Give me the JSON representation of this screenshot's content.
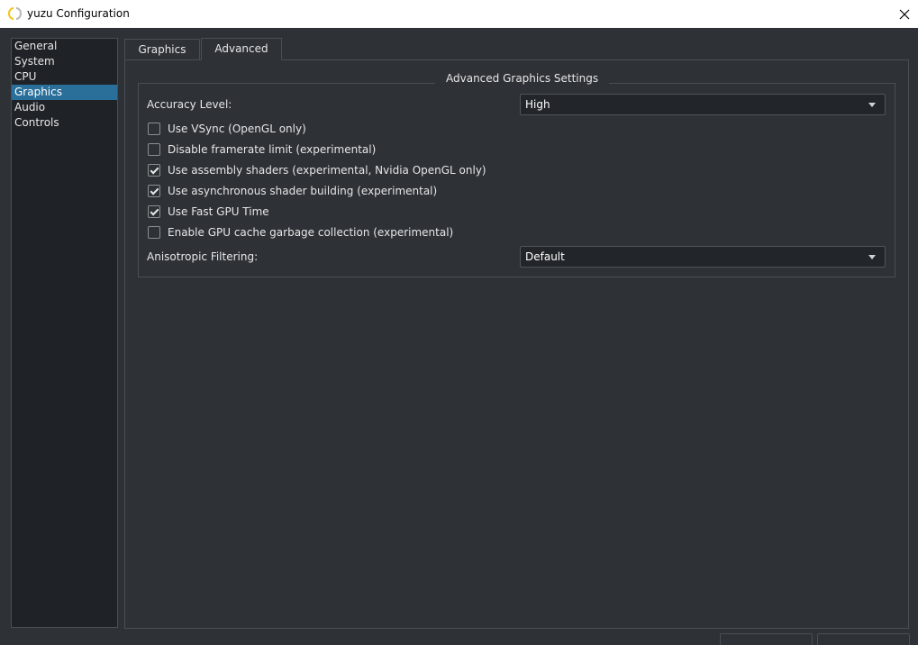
{
  "window": {
    "title": "yuzu Configuration",
    "icon": "yuzu-logo-icon",
    "close_icon": "close-icon"
  },
  "sidebar": {
    "items": [
      {
        "label": "General",
        "selected": false
      },
      {
        "label": "System",
        "selected": false
      },
      {
        "label": "CPU",
        "selected": false
      },
      {
        "label": "Graphics",
        "selected": true
      },
      {
        "label": "Audio",
        "selected": false
      },
      {
        "label": "Controls",
        "selected": false
      }
    ]
  },
  "tabs": [
    {
      "label": "Graphics",
      "active": false
    },
    {
      "label": "Advanced",
      "active": true
    }
  ],
  "advanced": {
    "group_title": "Advanced Graphics Settings",
    "accuracy_label": "Accuracy Level:",
    "accuracy_value": "High",
    "checkboxes": [
      {
        "label": "Use VSync (OpenGL only)",
        "checked": false
      },
      {
        "label": "Disable framerate limit (experimental)",
        "checked": false
      },
      {
        "label": "Use assembly shaders (experimental, Nvidia OpenGL only)",
        "checked": true
      },
      {
        "label": "Use asynchronous shader building (experimental)",
        "checked": true
      },
      {
        "label": "Use Fast GPU Time",
        "checked": true
      },
      {
        "label": "Enable GPU cache garbage collection (experimental)",
        "checked": false
      }
    ],
    "anisotropic_label": "Anisotropic Filtering:",
    "anisotropic_value": "Default"
  },
  "colors": {
    "background": "#2e3237",
    "selection": "#2a6f9a",
    "logo_yellow": "#f5c518"
  }
}
